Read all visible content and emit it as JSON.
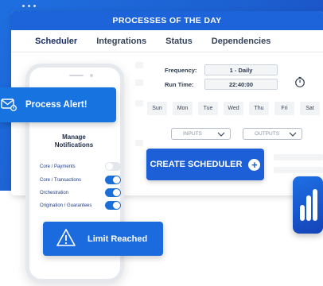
{
  "window": {
    "title": "PROCESSES OF THE DAY"
  },
  "tabs": [
    "Scheduler",
    "Integrations",
    "Status",
    "Dependencies"
  ],
  "scheduler": {
    "frequency_label": "Frequency:",
    "frequency_value": "1 - Daily",
    "runtime_label": "Run Time:",
    "runtime_value": "22:40:00",
    "days": [
      "Sun",
      "Mon",
      "Tue",
      "Wed",
      "Thu",
      "Fri",
      "Sat"
    ],
    "inputs_label": "INPUTS",
    "outputs_label": "OUTPUTS",
    "create_label": "CREATE SCHEDULER"
  },
  "alert": {
    "label": "Process Alert!"
  },
  "phone": {
    "manage_title": "Manage Notifications",
    "toggles": [
      {
        "label": "Core / Payments",
        "on": false
      },
      {
        "label": "Core / Transactions",
        "on": true
      },
      {
        "label": "Orchestration",
        "on": true
      },
      {
        "label": "Origination / Guarantees",
        "on": true
      }
    ]
  },
  "limit": {
    "label": "Limit Reached"
  },
  "colors": {
    "accent": "#1d63d9",
    "text_dark": "#1f2d4a"
  },
  "icons": {
    "alert": "mail-alert-icon",
    "limit": "warning-triangle-icon",
    "clock": "stopwatch-icon",
    "add": "plus-icon",
    "chart": "bar-chart-icon"
  }
}
